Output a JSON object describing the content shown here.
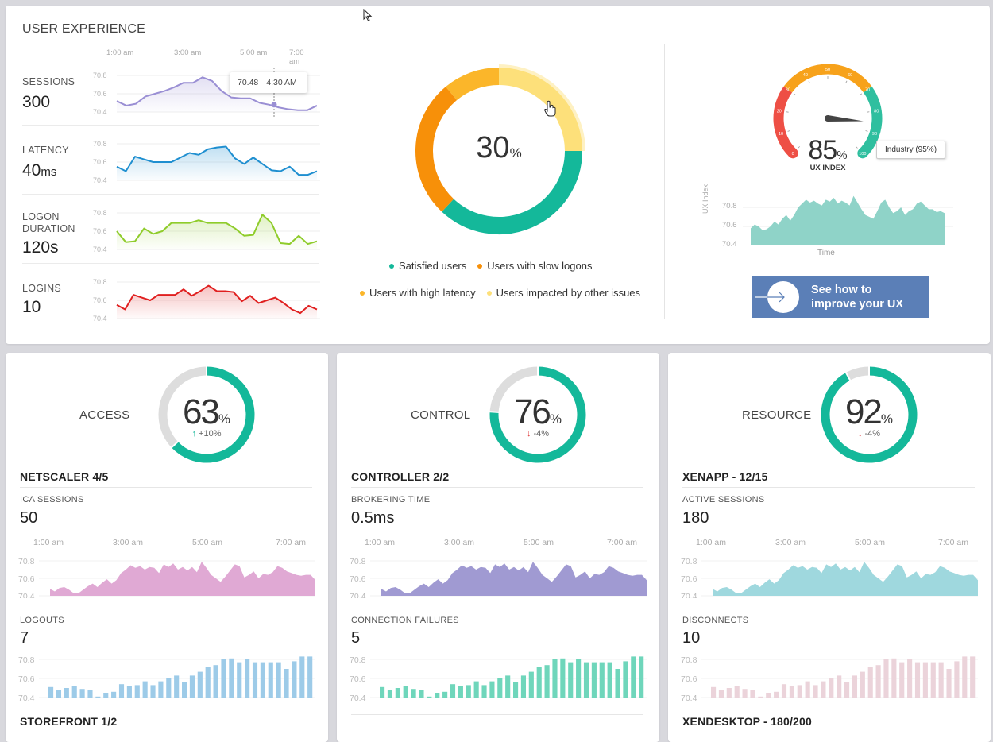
{
  "user_experience": {
    "title": "USER EXPERIENCE",
    "time_ticks": [
      "1:00 am",
      "3:00 am",
      "5:00 am",
      "7:00 am"
    ],
    "y_ticks": [
      "70.8",
      "70.6",
      "70.4"
    ],
    "metrics": [
      {
        "label": "SESSIONS",
        "value": "300",
        "unit": "",
        "color": "#9a8fd4",
        "series": [
          70.52,
          70.47,
          70.49,
          70.57,
          70.6,
          70.63,
          70.67,
          70.72,
          70.72,
          70.78,
          70.74,
          70.63,
          70.56,
          70.55,
          70.55,
          70.5,
          70.48,
          70.45,
          70.43,
          70.42,
          70.42,
          70.47
        ]
      },
      {
        "label": "LATENCY",
        "value": "40",
        "unit": "ms",
        "color": "#1f8fd0",
        "series": [
          70.55,
          70.5,
          70.66,
          70.63,
          70.6,
          70.6,
          70.6,
          70.65,
          70.7,
          70.68,
          70.74,
          70.76,
          70.77,
          70.64,
          70.58,
          70.65,
          70.58,
          70.51,
          70.5,
          70.55,
          70.46,
          70.46,
          70.5
        ]
      },
      {
        "label_lines": [
          "LOGON",
          "DURATION"
        ],
        "value": "120s",
        "unit": "",
        "color": "#8fcc2b",
        "series": [
          70.6,
          70.48,
          70.49,
          70.63,
          70.57,
          70.6,
          70.69,
          70.69,
          70.69,
          70.72,
          70.69,
          70.69,
          70.69,
          70.63,
          70.55,
          70.56,
          70.78,
          70.69,
          70.47,
          70.46,
          70.55,
          70.46,
          70.49
        ]
      },
      {
        "label": "LOGINS",
        "value": "10",
        "unit": "",
        "color": "#e02020",
        "series": [
          70.55,
          70.5,
          70.66,
          70.63,
          70.6,
          70.66,
          70.66,
          70.66,
          70.72,
          70.65,
          70.7,
          70.76,
          70.7,
          70.7,
          70.69,
          70.59,
          70.65,
          70.57,
          70.6,
          70.63,
          70.57,
          70.5,
          70.46,
          70.54,
          70.5
        ]
      }
    ],
    "tooltip": {
      "value": "70.48",
      "time": "4:30 AM"
    }
  },
  "donut": {
    "center_value": "30",
    "center_unit": "%",
    "segments": [
      {
        "name": "Users impacted by other issues",
        "share": 0.25,
        "color": "#fde07a"
      },
      {
        "name": "Satisfied users",
        "share": 0.37,
        "color": "#14b89a"
      },
      {
        "name": "Users with slow logons",
        "share": 0.27,
        "color": "#f79009"
      },
      {
        "name": "Users with high latency",
        "share": 0.11,
        "color": "#fbb62a"
      }
    ],
    "legend_row1": [
      {
        "label": "Satisfied users",
        "color": "#14b89a"
      },
      {
        "label": "Users with slow logons",
        "color": "#f79009"
      }
    ],
    "legend_row2": [
      {
        "label": "Users with high latency",
        "color": "#fbb62a"
      },
      {
        "label": "Users impacted by other issues",
        "color": "#fde07a"
      }
    ]
  },
  "gauge": {
    "value": "85",
    "value_number": 85,
    "unit": "%",
    "label": "UX INDEX",
    "tick_labels": [
      "0",
      "10",
      "20",
      "30",
      "40",
      "50",
      "60",
      "70",
      "80",
      "90",
      "100"
    ],
    "bands": [
      {
        "from": 0,
        "to": 30,
        "color": "#ee4f45"
      },
      {
        "from": 30,
        "to": 70,
        "color": "#f7a21b"
      },
      {
        "from": 70,
        "to": 100,
        "color": "#2fbf9f"
      }
    ],
    "industry_label": "Industry (95%)",
    "chart_ylabel": "UX Index",
    "chart_xlabel": "Time",
    "chart_y_ticks": [
      "70.8",
      "70.6",
      "70.4"
    ],
    "chart_color": "#8fd3c8",
    "chart_series": [
      70.58,
      70.62,
      70.6,
      70.56,
      70.57,
      70.6,
      70.65,
      70.62,
      70.68,
      70.72,
      70.66,
      70.72,
      70.8,
      70.84,
      70.88,
      70.85,
      70.87,
      70.84,
      70.82,
      70.88,
      70.86,
      70.9,
      70.84,
      70.87,
      70.85,
      70.82,
      70.92,
      70.85,
      70.78,
      70.72,
      70.7,
      70.68,
      70.76,
      70.85,
      70.88,
      70.8,
      70.74,
      70.76,
      70.8,
      70.72,
      70.76,
      70.78,
      70.84,
      70.86,
      70.82,
      70.78,
      70.78,
      70.75,
      70.76,
      70.74
    ]
  },
  "cta": {
    "line1": "See how to",
    "line2": "improve your UX"
  },
  "cards": [
    {
      "name": "ACCESS",
      "percent": "63",
      "percent_number": 63,
      "delta": "+10%",
      "delta_dir": "up",
      "section": "NETSCALER 4/5",
      "metric1_label": "ICA SESSIONS",
      "metric1_value": "50",
      "area_color": "#e0a9d4",
      "metric2_label": "LOGOUTS",
      "metric2_value": "7",
      "bar_color": "#9dcbe8",
      "footer": "STOREFRONT 1/2"
    },
    {
      "name": "CONTROL",
      "percent": "76",
      "percent_number": 76,
      "delta": "-4%",
      "delta_dir": "down",
      "section": "CONTROLLER 2/2",
      "metric1_label": "BROKERING TIME",
      "metric1_value": "0.5ms",
      "area_color": "#a09ad2",
      "metric2_label": "CONNECTION FAILURES",
      "metric2_value": "5",
      "bar_color": "#6fd6bb",
      "footer": ""
    },
    {
      "name": "RESOURCE",
      "percent": "92",
      "percent_number": 92,
      "delta": "-4%",
      "delta_dir": "down",
      "section": "XENAPP - 12/15",
      "metric1_label": "ACTIVE SESSIONS",
      "metric1_value": "180",
      "area_color": "#9fd8de",
      "metric2_label": "DISCONNECTS",
      "metric2_value": "10",
      "bar_color": "#ebd3da",
      "footer": "XENDESKTOP - 180/200"
    }
  ],
  "card_time_ticks": [
    "1:00 am",
    "3:00 am",
    "5:00 am",
    "7:00 am"
  ],
  "card_y_ticks": [
    "70.8",
    "70.6",
    "70.4"
  ],
  "card_area_series": [
    70.48,
    70.45,
    70.49,
    70.5,
    70.47,
    70.43,
    70.43,
    70.47,
    70.51,
    70.54,
    70.5,
    70.55,
    70.59,
    70.54,
    70.58,
    70.66,
    70.7,
    70.75,
    70.72,
    70.74,
    70.7,
    70.73,
    70.72,
    70.66,
    70.76,
    70.73,
    70.77,
    70.7,
    70.73,
    70.69,
    70.73,
    70.67,
    70.79,
    70.72,
    70.64,
    70.6,
    70.56,
    70.62,
    70.69,
    70.76,
    70.74,
    70.61,
    70.64,
    70.68,
    70.6,
    70.65,
    70.64,
    70.67,
    70.74,
    70.72,
    70.68,
    70.66,
    70.64,
    70.63,
    70.64,
    70.64,
    70.58
  ],
  "card_bar_series": [
    70.51,
    70.48,
    70.5,
    70.52,
    70.49,
    70.48,
    70.41,
    70.45,
    70.46,
    70.54,
    70.52,
    70.53,
    70.57,
    70.53,
    70.57,
    70.6,
    70.63,
    70.56,
    70.63,
    70.67,
    70.72,
    70.74,
    70.8,
    70.81,
    70.77,
    70.8,
    70.77,
    70.77,
    70.77,
    70.77,
    70.7,
    70.78,
    70.83,
    70.83
  ]
}
